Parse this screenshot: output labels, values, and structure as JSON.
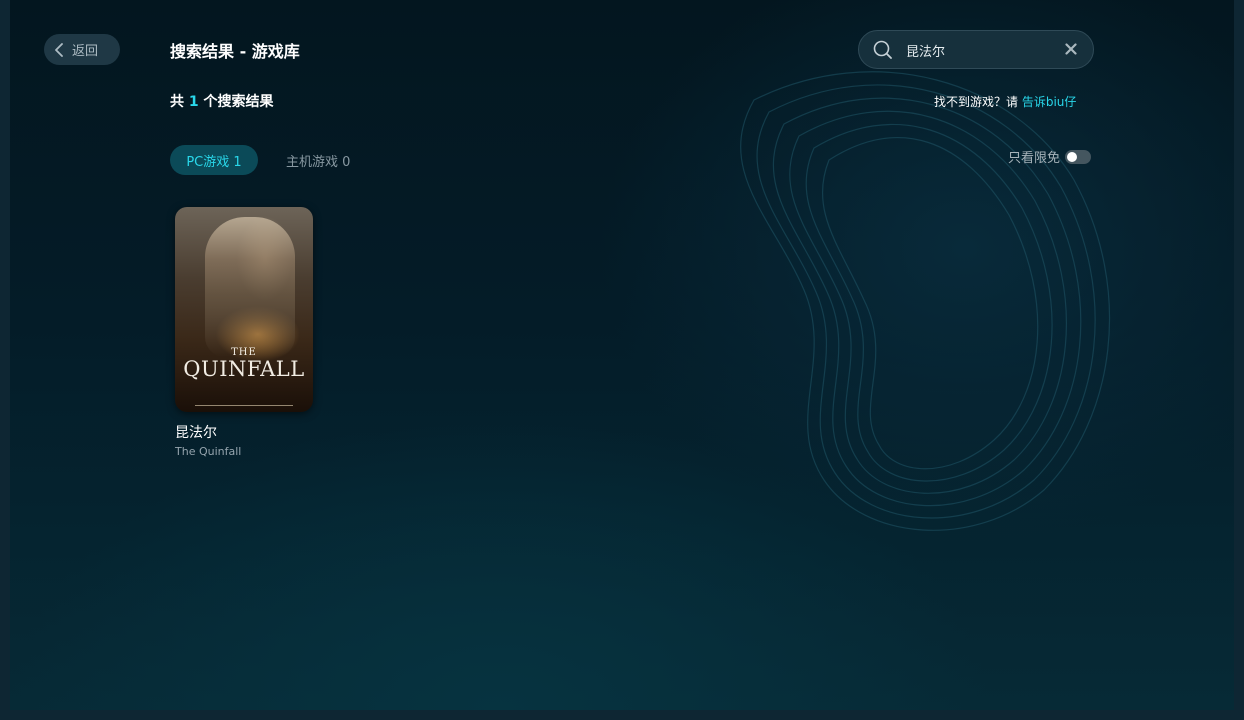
{
  "header": {
    "back_label": "返回",
    "title": "搜索结果 - 游戏库"
  },
  "search": {
    "value": "昆法尔",
    "placeholder": ""
  },
  "results": {
    "prefix": "共 ",
    "count": "1",
    "suffix": " 个搜索结果"
  },
  "feedback": {
    "text": "找不到游戏？请 ",
    "link": "告诉biu仔"
  },
  "tabs": [
    {
      "label": "PC游戏 1",
      "active": true
    },
    {
      "label": "主机游戏 0",
      "active": false
    }
  ],
  "filter": {
    "label": "只看限免",
    "enabled": false
  },
  "games": [
    {
      "name": "昆法尔",
      "subtitle": "The Quinfall",
      "cover_the": "THE",
      "cover_title": "QUINFALL"
    }
  ],
  "colors": {
    "accent": "#29d7ea",
    "background": "#041c28",
    "tab_active_bg": "#0b4a58"
  }
}
